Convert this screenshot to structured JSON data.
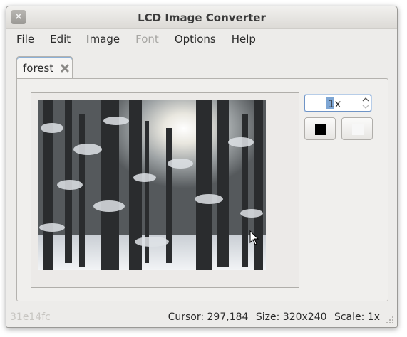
{
  "window": {
    "title": "LCD Image Converter",
    "close_glyph": "×"
  },
  "menubar": {
    "items": [
      {
        "label": "File",
        "enabled": true
      },
      {
        "label": "Edit",
        "enabled": true
      },
      {
        "label": "Image",
        "enabled": true
      },
      {
        "label": "Font",
        "enabled": false
      },
      {
        "label": "Options",
        "enabled": true
      },
      {
        "label": "Help",
        "enabled": true
      }
    ]
  },
  "tabs": [
    {
      "label": "forest",
      "active": true,
      "close_icon": "close-icon"
    }
  ],
  "editor": {
    "image_description": "forest",
    "scale": {
      "value": "1x"
    },
    "foreground_color": "#000000",
    "background_color": "#ffffff"
  },
  "statusbar": {
    "color_value": "31e14fc",
    "cursor": "Cursor: 297,184",
    "size": "Size: 320x240",
    "scale": "Scale: 1x"
  }
}
